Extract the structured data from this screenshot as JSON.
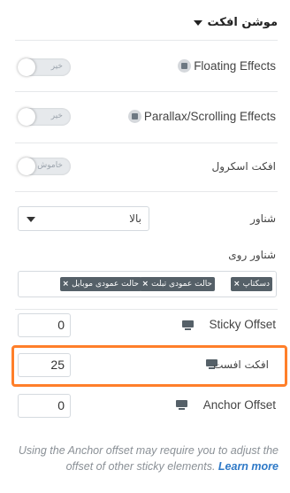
{
  "section": {
    "title": "موشن افکت"
  },
  "floating": {
    "label": "Floating Effects",
    "toggle_text": "خیر"
  },
  "parallax": {
    "label": "Parallax/Scrolling Effects",
    "toggle_text": "خیر"
  },
  "scroll_effects": {
    "label": "افکت اسکرول",
    "toggle_text": "خاموش"
  },
  "sticky": {
    "label": "شناور",
    "value": "بالا"
  },
  "sticky_on": {
    "label": "شناور روی",
    "tags": [
      "دسکتاپ",
      "حالت عمودی تبلت",
      "حالت عمودی موبایل"
    ]
  },
  "sticky_offset": {
    "label": "Sticky Offset",
    "value": "0"
  },
  "effects_offset": {
    "label": "افکت افست",
    "value": "25"
  },
  "anchor_offset": {
    "label": "Anchor Offset",
    "value": "0"
  },
  "note": {
    "text": "Using the Anchor offset may require you to adjust the offset of other sticky elements.",
    "link": "Learn more"
  },
  "colors": {
    "highlight": "#ff7f2a",
    "link": "#2e79c7",
    "tag_bg": "#556068"
  }
}
